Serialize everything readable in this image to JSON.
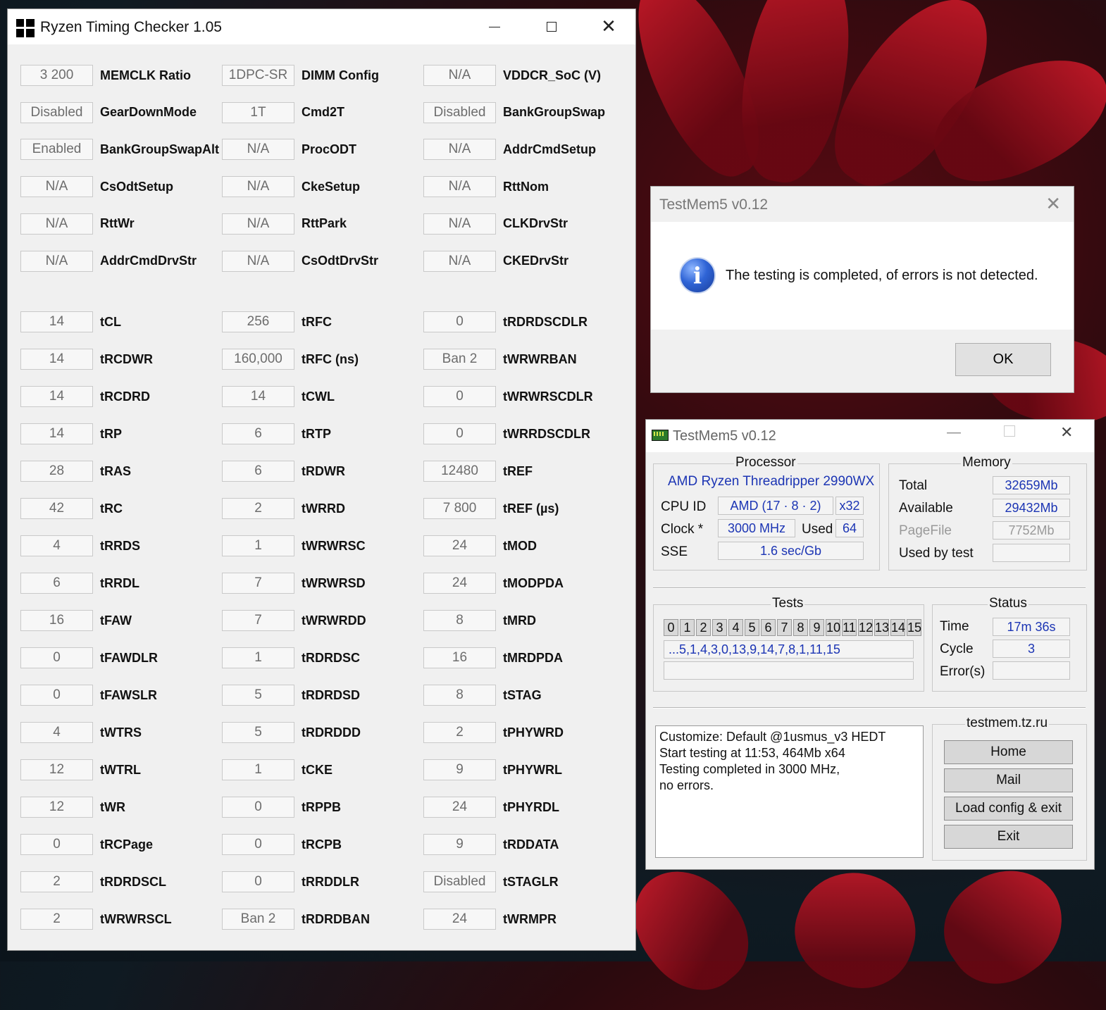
{
  "rtc": {
    "title": "Ryzen Timing Checker 1.05",
    "columns": [
      [
        {
          "value": "3 200",
          "label": "MEMCLK Ratio"
        },
        {
          "value": "Disabled",
          "label": "GearDownMode"
        },
        {
          "value": "Enabled",
          "label": "BankGroupSwapAlt"
        },
        {
          "value": "N/A",
          "label": "CsOdtSetup"
        },
        {
          "value": "N/A",
          "label": "RttWr"
        },
        {
          "value": "N/A",
          "label": "AddrCmdDrvStr"
        },
        {
          "value": "14",
          "label": "tCL"
        },
        {
          "value": "14",
          "label": "tRCDWR"
        },
        {
          "value": "14",
          "label": "tRCDRD"
        },
        {
          "value": "14",
          "label": "tRP"
        },
        {
          "value": "28",
          "label": "tRAS"
        },
        {
          "value": "42",
          "label": "tRC"
        },
        {
          "value": "4",
          "label": "tRRDS"
        },
        {
          "value": "6",
          "label": "tRRDL"
        },
        {
          "value": "16",
          "label": "tFAW"
        },
        {
          "value": "0",
          "label": "tFAWDLR"
        },
        {
          "value": "0",
          "label": "tFAWSLR"
        },
        {
          "value": "4",
          "label": "tWTRS"
        },
        {
          "value": "12",
          "label": "tWTRL"
        },
        {
          "value": "12",
          "label": "tWR"
        },
        {
          "value": "0",
          "label": "tRCPage"
        },
        {
          "value": "2",
          "label": "tRDRDSCL"
        },
        {
          "value": "2",
          "label": "tWRWRSCL"
        }
      ],
      [
        {
          "value": "1DPC-SR",
          "label": "DIMM Config"
        },
        {
          "value": "1T",
          "label": "Cmd2T"
        },
        {
          "value": "N/A",
          "label": "ProcODT"
        },
        {
          "value": "N/A",
          "label": "CkeSetup"
        },
        {
          "value": "N/A",
          "label": "RttPark"
        },
        {
          "value": "N/A",
          "label": "CsOdtDrvStr"
        },
        {
          "value": "256",
          "label": "tRFC"
        },
        {
          "value": "160,000",
          "label": "tRFC (ns)"
        },
        {
          "value": "14",
          "label": "tCWL"
        },
        {
          "value": "6",
          "label": "tRTP"
        },
        {
          "value": "6",
          "label": "tRDWR"
        },
        {
          "value": "2",
          "label": "tWRRD"
        },
        {
          "value": "1",
          "label": "tWRWRSC"
        },
        {
          "value": "7",
          "label": "tWRWRSD"
        },
        {
          "value": "7",
          "label": "tWRWRDD"
        },
        {
          "value": "1",
          "label": "tRDRDSC"
        },
        {
          "value": "5",
          "label": "tRDRDSD"
        },
        {
          "value": "5",
          "label": "tRDRDDD"
        },
        {
          "value": "1",
          "label": "tCKE"
        },
        {
          "value": "0",
          "label": "tRPPB"
        },
        {
          "value": "0",
          "label": "tRCPB"
        },
        {
          "value": "0",
          "label": "tRRDDLR"
        },
        {
          "value": "Ban 2",
          "label": "tRDRDBAN"
        }
      ],
      [
        {
          "value": "N/A",
          "label": "VDDCR_SoC (V)"
        },
        {
          "value": "Disabled",
          "label": "BankGroupSwap"
        },
        {
          "value": "N/A",
          "label": "AddrCmdSetup"
        },
        {
          "value": "N/A",
          "label": "RttNom"
        },
        {
          "value": "N/A",
          "label": "CLKDrvStr"
        },
        {
          "value": "N/A",
          "label": "CKEDrvStr"
        },
        {
          "value": "0",
          "label": "tRDRDSCDLR"
        },
        {
          "value": "Ban 2",
          "label": "tWRWRBAN"
        },
        {
          "value": "0",
          "label": "tWRWRSCDLR"
        },
        {
          "value": "0",
          "label": "tWRRDSCDLR"
        },
        {
          "value": "12480",
          "label": "tREF"
        },
        {
          "value": "7 800",
          "label": "tREF (µs)"
        },
        {
          "value": "24",
          "label": "tMOD"
        },
        {
          "value": "24",
          "label": "tMODPDA"
        },
        {
          "value": "8",
          "label": "tMRD"
        },
        {
          "value": "16",
          "label": "tMRDPDA"
        },
        {
          "value": "8",
          "label": "tSTAG"
        },
        {
          "value": "2",
          "label": "tPHYWRD"
        },
        {
          "value": "9",
          "label": "tPHYWRL"
        },
        {
          "value": "24",
          "label": "tPHYRDL"
        },
        {
          "value": "9",
          "label": "tRDDATA"
        },
        {
          "value": "Disabled",
          "label": "tSTAGLR"
        },
        {
          "value": "24",
          "label": "tWRMPR"
        }
      ]
    ]
  },
  "dialog": {
    "title": "TestMem5 v0.12",
    "message": "The testing is completed, of errors is not detected.",
    "ok_label": "OK",
    "icon": "info-icon"
  },
  "testmem": {
    "title": "TestMem5 v0.12",
    "processor": {
      "group_title": "Processor",
      "name": "AMD Ryzen Threadripper 2990WX",
      "cpu_id_label": "CPU ID",
      "cpu_id_value": "AMD  (17 · 8 · 2)",
      "threads_value": "x32",
      "clock_label": "Clock *",
      "clock_value": "3000 MHz",
      "used_label": "Used",
      "used_value": "64",
      "sse_label": "SSE",
      "sse_value": "1.6 sec/Gb"
    },
    "memory": {
      "group_title": "Memory",
      "total_label": "Total",
      "total_value": "32659Mb",
      "available_label": "Available",
      "available_value": "29432Mb",
      "pagefile_label": "PageFile",
      "pagefile_value": "7752Mb",
      "used_by_test_label": "Used by test",
      "used_by_test_value": ""
    },
    "tests": {
      "group_title": "Tests",
      "numbers": [
        "0",
        "1",
        "2",
        "3",
        "4",
        "5",
        "6",
        "7",
        "8",
        "9",
        "10",
        "11",
        "12",
        "13",
        "14",
        "15"
      ],
      "sequence": "...5,1,4,3,0,13,9,14,7,8,1,11,15",
      "progress": ""
    },
    "status": {
      "group_title": "Status",
      "time_label": "Time",
      "time_value": "17m 36s",
      "cycle_label": "Cycle",
      "cycle_value": "3",
      "errors_label": "Error(s)",
      "errors_value": ""
    },
    "log": [
      "Customize: Default @1usmus_v3 HEDT",
      "Start testing at 11:53, 464Mb x64",
      "Testing completed in 3000 MHz,",
      "no errors."
    ],
    "links": {
      "group_title": "testmem.tz.ru",
      "home": "Home",
      "mail": "Mail",
      "load": "Load config & exit",
      "exit": "Exit"
    }
  }
}
